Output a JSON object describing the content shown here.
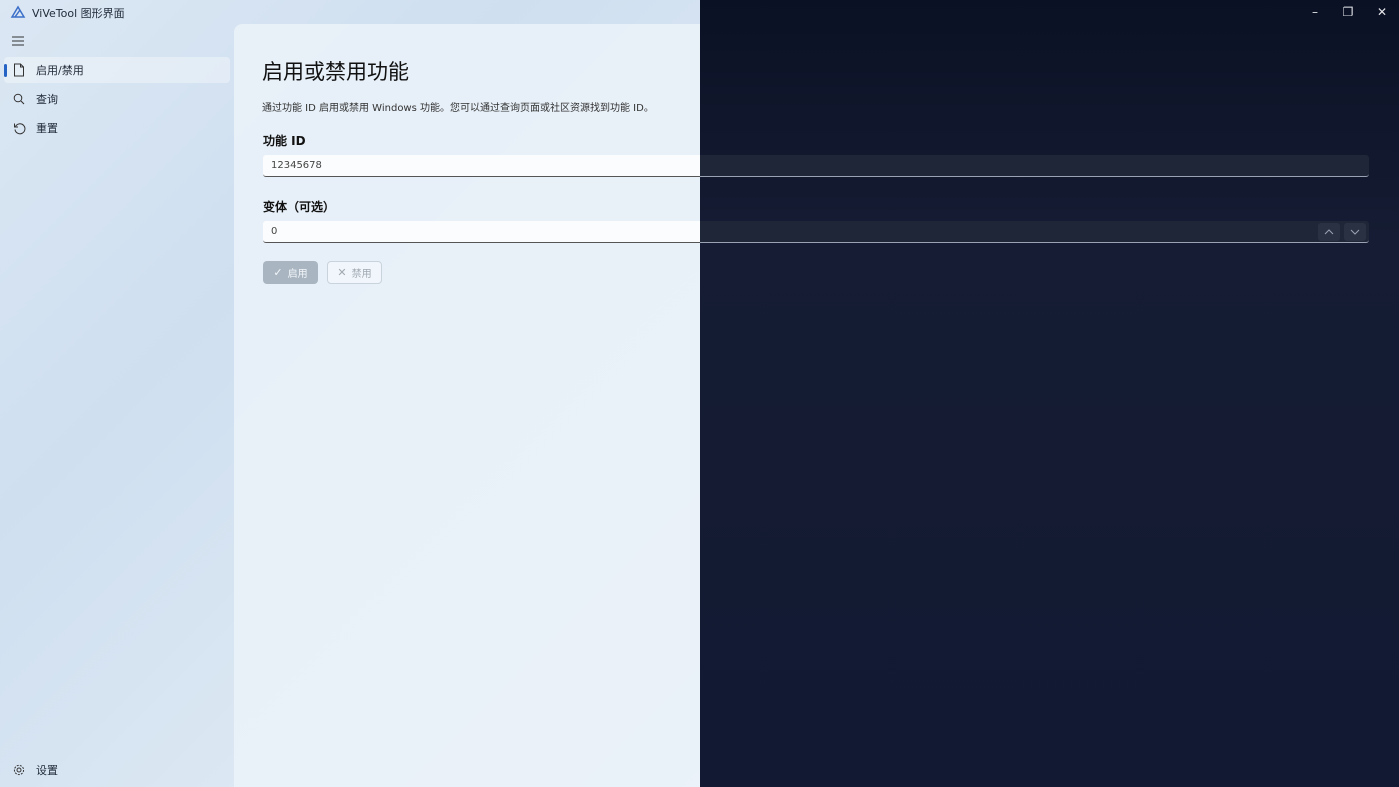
{
  "app": {
    "title": "ViVeTool 图形界面"
  },
  "window_controls": {
    "minimize": "–",
    "restore": "❐",
    "close": "✕"
  },
  "sidebar": {
    "items": [
      {
        "label": "启用/禁用",
        "icon": "document-icon",
        "active": true
      },
      {
        "label": "查询",
        "icon": "search-icon",
        "active": false
      },
      {
        "label": "重置",
        "icon": "reset-icon",
        "active": false
      }
    ],
    "settings_label": "设置"
  },
  "main": {
    "title": "启用或禁用功能",
    "description": "通过功能 ID 启用或禁用 Windows 功能。您可以通过查询页面或社区资源找到功能 ID。",
    "feature_id": {
      "label": "功能 ID",
      "value": "12345678"
    },
    "variant": {
      "label": "变体（可选）",
      "value": "0"
    },
    "enable_label": "启用",
    "disable_label": "禁用"
  },
  "colors": {
    "accent": "#2563c4",
    "dark_bg": "#141a2e",
    "light_bg": "#dbe7f3"
  }
}
